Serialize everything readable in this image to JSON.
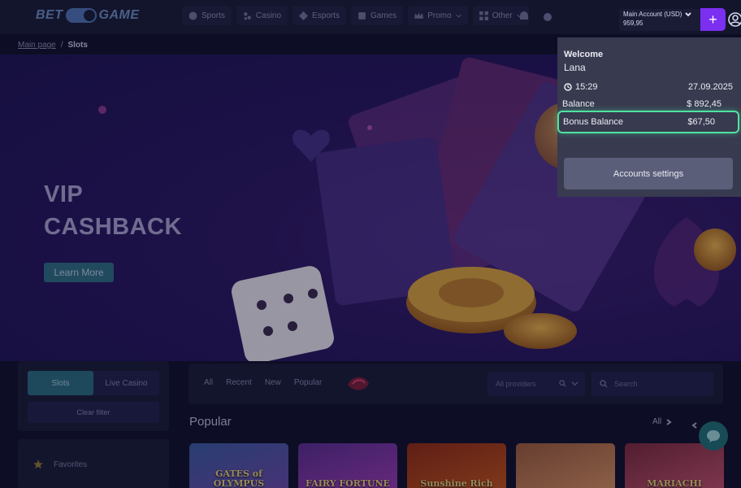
{
  "header": {
    "logo_left": "BET",
    "logo_right": "GAME",
    "nav": [
      {
        "label": "Sports",
        "icon": "soccer-ball-icon"
      },
      {
        "label": "Casino",
        "icon": "slot-machine-icon"
      },
      {
        "label": "Esports",
        "icon": "gamepad-icon"
      },
      {
        "label": "Games",
        "icon": "games-icon"
      },
      {
        "label": "Promo",
        "icon": "crown-icon",
        "dropdown": true
      },
      {
        "label": "Other",
        "icon": "grid-icon",
        "dropdown": true
      }
    ]
  },
  "account": {
    "name": "Main Account (USD)",
    "balance": "959,95",
    "plus": "+"
  },
  "popup": {
    "welcome": "Welcome",
    "user": "Lana",
    "time": "15:29",
    "date": "27.09.2025",
    "balance_label": "Balance",
    "balance_value": "$ 892,45",
    "bonus_label": "Bonus Balance",
    "bonus_value": "$67,50",
    "settings_button": "Accounts settings",
    "highlight_color": "#4fe3a0"
  },
  "breadcrumb": {
    "home": "Main page",
    "sep": "/",
    "current": "Slots"
  },
  "hero": {
    "title_line1": "VIP",
    "title_line2": "CASHBACK",
    "button": "Learn More"
  },
  "sidebar": {
    "tabs": [
      "Slots",
      "Live Casino"
    ],
    "active_tab": "Slots",
    "clear_filter": "Clear filter",
    "favorites": "Favorites"
  },
  "filters": {
    "tabs": [
      "All",
      "Recent",
      "New",
      "Popular"
    ],
    "providers_placeholder": "All providers",
    "search_placeholder": "Search"
  },
  "popular": {
    "title": "Popular",
    "all_link": "All",
    "games": [
      {
        "name": "GATES of OLYMPUS",
        "colors": [
          "#3a5a9e",
          "#6a4aa8"
        ]
      },
      {
        "name": "FAIRY FORTUNE",
        "colors": [
          "#5a2e8e",
          "#9a3ab0"
        ]
      },
      {
        "name": "Sunshine Rich",
        "colors": [
          "#8e2a12",
          "#c2541a"
        ]
      },
      {
        "name": "",
        "colors": [
          "#9a5a3a",
          "#d49060"
        ]
      },
      {
        "name": "MARIACHI",
        "colors": [
          "#7a2a3a",
          "#c0506a"
        ]
      }
    ]
  }
}
